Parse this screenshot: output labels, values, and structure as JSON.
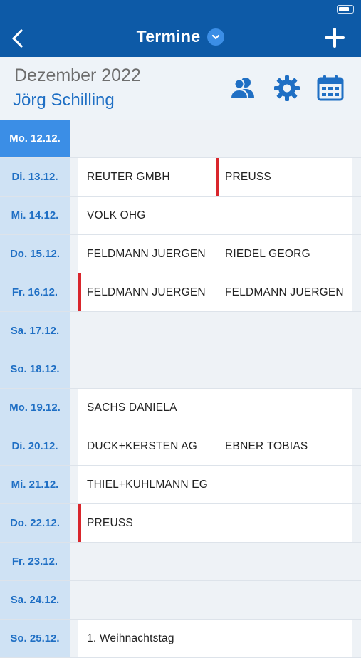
{
  "header": {
    "title": "Termine"
  },
  "subheader": {
    "month": "Dezember 2022",
    "person": "Jörg Schilling"
  },
  "colors": {
    "primary": "#0d5aa7",
    "accent": "#1f6fc4",
    "marker": "#d9262c"
  },
  "icons": [
    "back-icon",
    "chevron-down-icon",
    "plus-icon",
    "people-icon",
    "gear-icon",
    "calendar-icon"
  ],
  "days": [
    {
      "date": "Mo. 12.12.",
      "active": true,
      "entries": []
    },
    {
      "date": "Di. 13.12.",
      "entries": [
        {
          "text": "REUTER GMBH",
          "marked": false
        },
        {
          "text": "PREUSS",
          "marked": true
        }
      ]
    },
    {
      "date": "Mi. 14.12.",
      "entries": [
        {
          "text": "VOLK OHG",
          "marked": false
        }
      ]
    },
    {
      "date": "Do. 15.12.",
      "entries": [
        {
          "text": "FELDMANN JUERGEN",
          "marked": false
        },
        {
          "text": "RIEDEL GEORG",
          "marked": false
        }
      ]
    },
    {
      "date": "Fr. 16.12.",
      "entries": [
        {
          "text": "FELDMANN JUERGEN",
          "marked": true
        },
        {
          "text": "FELDMANN JUERGEN",
          "marked": false
        }
      ]
    },
    {
      "date": "Sa. 17.12.",
      "entries": []
    },
    {
      "date": "So. 18.12.",
      "entries": []
    },
    {
      "date": "Mo. 19.12.",
      "entries": [
        {
          "text": "SACHS DANIELA",
          "marked": false
        }
      ]
    },
    {
      "date": "Di. 20.12.",
      "entries": [
        {
          "text": "DUCK+KERSTEN AG",
          "marked": false
        },
        {
          "text": "EBNER TOBIAS",
          "marked": false
        }
      ]
    },
    {
      "date": "Mi. 21.12.",
      "entries": [
        {
          "text": "THIEL+KUHLMANN EG",
          "marked": false
        }
      ]
    },
    {
      "date": "Do. 22.12.",
      "entries": [
        {
          "text": "PREUSS",
          "marked": true
        }
      ]
    },
    {
      "date": "Fr. 23.12.",
      "entries": []
    },
    {
      "date": "Sa. 24.12.",
      "entries": []
    },
    {
      "date": "So. 25.12.",
      "entries": [
        {
          "text": "1. Weihnachtstag",
          "marked": false
        }
      ]
    }
  ]
}
